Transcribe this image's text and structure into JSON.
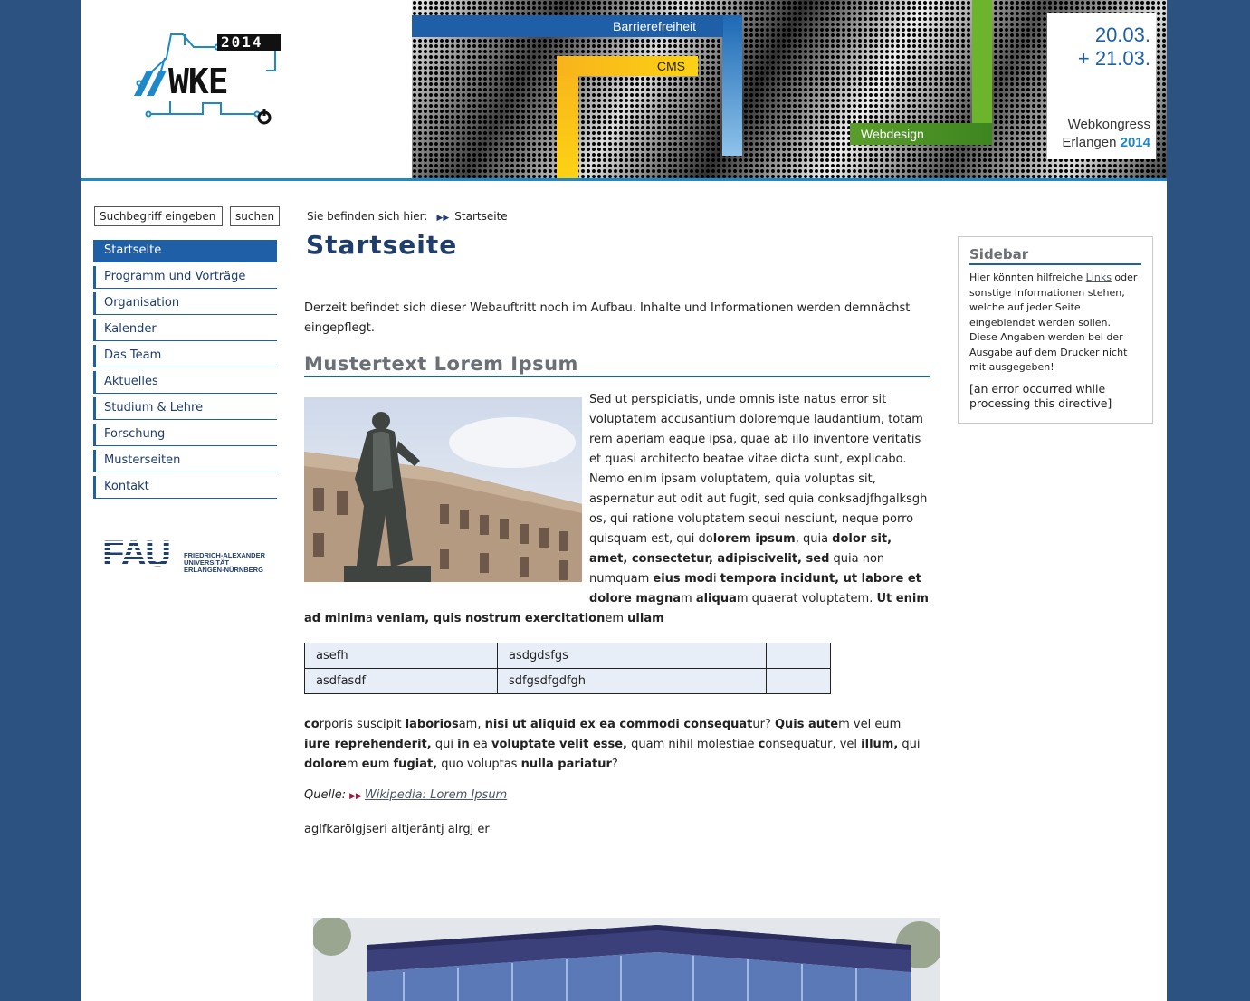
{
  "header": {
    "logo_year": "2014",
    "logo_text": "//WKE",
    "ribbons": {
      "barrierefreiheit": "Barrierefreiheit",
      "cms": "CMS",
      "webdesign": "Webdesign"
    },
    "date_line1": "20.03.",
    "date_line2": "+ 21.03.",
    "kongress_line1": "Webkongress",
    "kongress_city": "Erlangen",
    "kongress_year": "2014"
  },
  "search": {
    "value": "Suchbegriff eingeben",
    "button_label": "suchen"
  },
  "nav": {
    "items": [
      {
        "label": "Startseite"
      },
      {
        "label": "Programm und Vorträge"
      },
      {
        "label": "Organisation"
      },
      {
        "label": "Kalender"
      },
      {
        "label": "Das Team"
      },
      {
        "label": "Aktuelles"
      },
      {
        "label": "Studium & Lehre"
      },
      {
        "label": "Forschung"
      },
      {
        "label": "Musterseiten"
      },
      {
        "label": "Kontakt"
      }
    ]
  },
  "fau": {
    "abbr": "FAU",
    "line1": "FRIEDRICH-ALEXANDER",
    "line2": "UNIVERSITÄT",
    "line3": "ERLANGEN-NÜRNBERG"
  },
  "breadcrumb": {
    "prefix": "Sie befinden sich hier:",
    "current": "Startseite"
  },
  "main": {
    "title": "Startseite",
    "intro": "Derzeit befindet sich dieser Webauftritt noch im Aufbau. Inhalte und Informationen werden demnächst eingepflegt.",
    "heading": "Mustertext Lorem Ipsum",
    "table": [
      [
        "asefh",
        "asdgdsfgs",
        ""
      ],
      [
        "asdfasdf",
        "sdfgsdfgdfgh",
        ""
      ]
    ],
    "source_label": "Quelle:",
    "source_link": "Wikipedia: Lorem Ipsum",
    "extra_line": "aglfkarölgjseri altjeräntj alrgj er"
  },
  "sidebar": {
    "title": "Sidebar",
    "text_before_link": "Hier könnten hilfreiche ",
    "link": "Links",
    "text_after_link": " oder sonstige Informationen stehen, welche auf jeder Seite eingeblendet werden sollen. Diese Angaben werden bei der Ausgabe auf dem Drucker nicht mit ausgegeben!",
    "error": "[an error occurred while processing this directive]"
  }
}
